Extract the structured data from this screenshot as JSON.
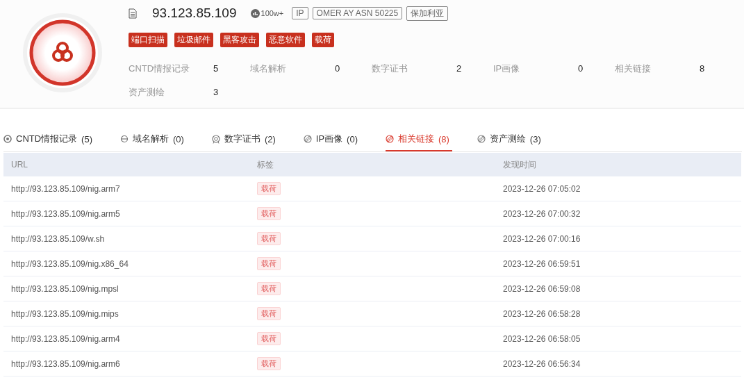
{
  "header": {
    "ip": "93.123.85.109",
    "heat": "100w+",
    "badges": [
      "IP",
      "OMER AY ASN 50225",
      "保加利亚"
    ],
    "tags": [
      "端口扫描",
      "垃圾邮件",
      "黑客攻击",
      "恶意软件",
      "载荷"
    ],
    "stats": [
      {
        "label": "CNTD情报记录",
        "value": "5"
      },
      {
        "label": "域名解析",
        "value": "0"
      },
      {
        "label": "数字证书",
        "value": "2"
      },
      {
        "label": "IP画像",
        "value": "0"
      },
      {
        "label": "相关链接",
        "value": "8"
      },
      {
        "label": "资产测绘",
        "value": "3"
      }
    ]
  },
  "tabs": [
    {
      "kind": "radar",
      "label": "CNTD情报记录",
      "count": "(5)",
      "selected": false
    },
    {
      "kind": "globe",
      "label": "域名解析",
      "count": "(0)",
      "selected": false
    },
    {
      "kind": "cert",
      "label": "数字证书",
      "count": "(2)",
      "selected": false
    },
    {
      "kind": "link",
      "label": "IP画像",
      "count": "(0)",
      "selected": false
    },
    {
      "kind": "link",
      "label": "相关链接",
      "count": "(8)",
      "selected": true
    },
    {
      "kind": "link",
      "label": "资产测绘",
      "count": "(3)",
      "selected": false
    }
  ],
  "table": {
    "columns": [
      "URL",
      "标签",
      "发现时间"
    ],
    "rows": [
      {
        "url": "http://93.123.85.109/nig.arm7",
        "tag": "载荷",
        "time": "2023-12-26 07:05:02"
      },
      {
        "url": "http://93.123.85.109/nig.arm5",
        "tag": "载荷",
        "time": "2023-12-26 07:00:32"
      },
      {
        "url": "http://93.123.85.109/w.sh",
        "tag": "载荷",
        "time": "2023-12-26 07:00:16"
      },
      {
        "url": "http://93.123.85.109/nig.x86_64",
        "tag": "载荷",
        "time": "2023-12-26 06:59:51"
      },
      {
        "url": "http://93.123.85.109/nig.mpsl",
        "tag": "载荷",
        "time": "2023-12-26 06:59:08"
      },
      {
        "url": "http://93.123.85.109/nig.mips",
        "tag": "载荷",
        "time": "2023-12-26 06:58:28"
      },
      {
        "url": "http://93.123.85.109/nig.arm4",
        "tag": "载荷",
        "time": "2023-12-26 06:58:05"
      },
      {
        "url": "http://93.123.85.109/nig.arm6",
        "tag": "载荷",
        "time": "2023-12-26 06:56:34"
      }
    ]
  }
}
